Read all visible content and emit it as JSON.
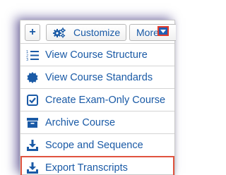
{
  "toolbar": {
    "add_label": "+",
    "customize_label": "Customize",
    "more_label": "More"
  },
  "menu": {
    "items": [
      {
        "label": "View Course Structure",
        "icon": "list-numbered-icon"
      },
      {
        "label": "View Course Standards",
        "icon": "badge-icon"
      },
      {
        "label": "Create Exam-Only Course",
        "icon": "checkbox-icon"
      },
      {
        "label": "Archive Course",
        "icon": "archive-icon"
      },
      {
        "label": "Scope and Sequence",
        "icon": "download-icon"
      },
      {
        "label": "Export Transcripts",
        "icon": "download-icon",
        "highlighted": true
      }
    ]
  },
  "colors": {
    "link": "#1a5aa6",
    "highlight_border": "#e0533f",
    "panel_shadow": "#23146e"
  }
}
